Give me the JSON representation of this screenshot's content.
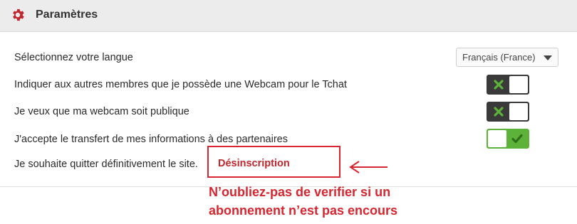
{
  "header": {
    "title": "Paramètres",
    "icon": "gear-icon",
    "icon_color": "#c0262d"
  },
  "settings": {
    "language": {
      "label": "Sélectionnez votre langue",
      "selected": "Français (France)"
    },
    "webcam_notice": {
      "label": "Indiquer aux autres membres que je possède une Webcam pour le Tchat",
      "enabled": false
    },
    "webcam_public": {
      "label": "Je veux que ma webcam soit publique",
      "enabled": false
    },
    "partner_transfer": {
      "label": "J'accepte le transfert de mes informations à des partenaires",
      "enabled": true
    },
    "unsubscribe": {
      "label": "Je souhaite quitter définitivement le site.",
      "link": "Désinscription"
    }
  },
  "annotation": {
    "line1": "N’oubliez-pas de verifier si un",
    "line2": "abonnement n’est pas encours",
    "color": "#d7262f"
  },
  "colors": {
    "toggle_off": "#3a3a3a",
    "toggle_on": "#5db33a",
    "off_icon": "#5db33a",
    "on_icon": "#2f6f1a"
  }
}
